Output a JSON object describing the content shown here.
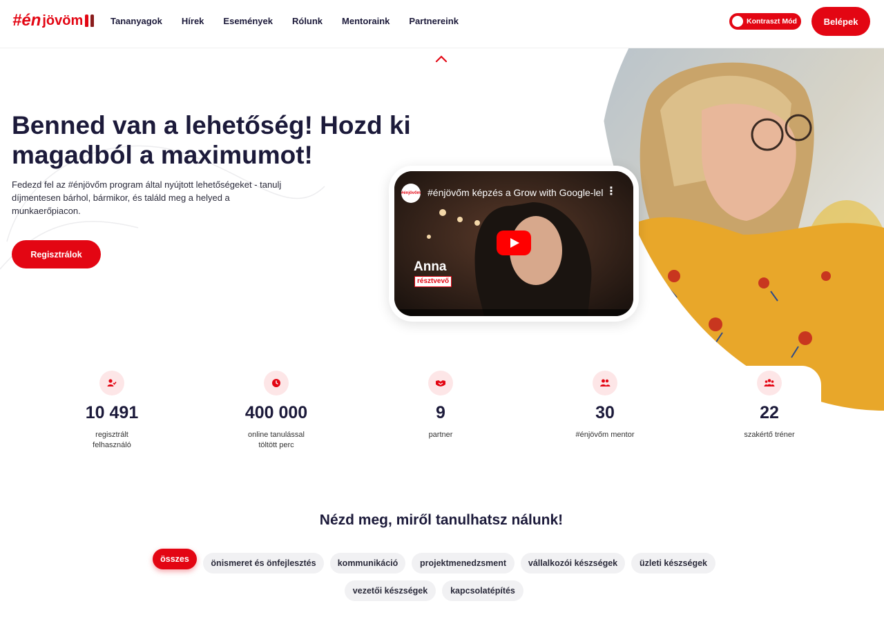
{
  "brand": {
    "hash": "#én",
    "word": "jövöm",
    "accent": "#e30613"
  },
  "nav": {
    "links": [
      "Tananyagok",
      "Hírek",
      "Események",
      "Rólunk",
      "Mentoraink",
      "Partnereink"
    ],
    "contrast_label": "Kontraszt Mód",
    "login_label": "Belépek"
  },
  "hero": {
    "title": "Benned van a lehetőség! Hozd ki magadból a maximumot!",
    "subtitle": "Fedezd fel az #énjövőm program által nyújtott lehetőségeket - tanulj díjmentesen bárhol, bármikor, és találd meg a helyed a munkaerőpiacon.",
    "register_label": "Regisztrálok"
  },
  "video": {
    "title": "#énjövőm képzés a Grow with Google-lel",
    "channel_badge": "#énjövőm",
    "person_name": "Anna",
    "person_role": "résztvevő"
  },
  "stats": [
    {
      "icon": "user-check-icon",
      "value": "10 491",
      "label": "regisztrált\nfelhasználó"
    },
    {
      "icon": "clock-icon",
      "value": "400 000",
      "label": "online tanulással\ntöltött perc"
    },
    {
      "icon": "handshake-icon",
      "value": "9",
      "label": "partner"
    },
    {
      "icon": "users-icon",
      "value": "30",
      "label": "#énjövőm mentor"
    },
    {
      "icon": "group-icon",
      "value": "22",
      "label": "szakértő tréner"
    }
  ],
  "learn": {
    "title": "Nézd meg, miről tanulhatsz nálunk!",
    "filters": [
      "összes",
      "önismeret és önfejlesztés",
      "kommunikáció",
      "projektmenedzsment",
      "vállalkozói készségek",
      "üzleti készségek",
      "vezetői készségek",
      "kapcsolatépítés"
    ],
    "active_filter": "összes"
  }
}
